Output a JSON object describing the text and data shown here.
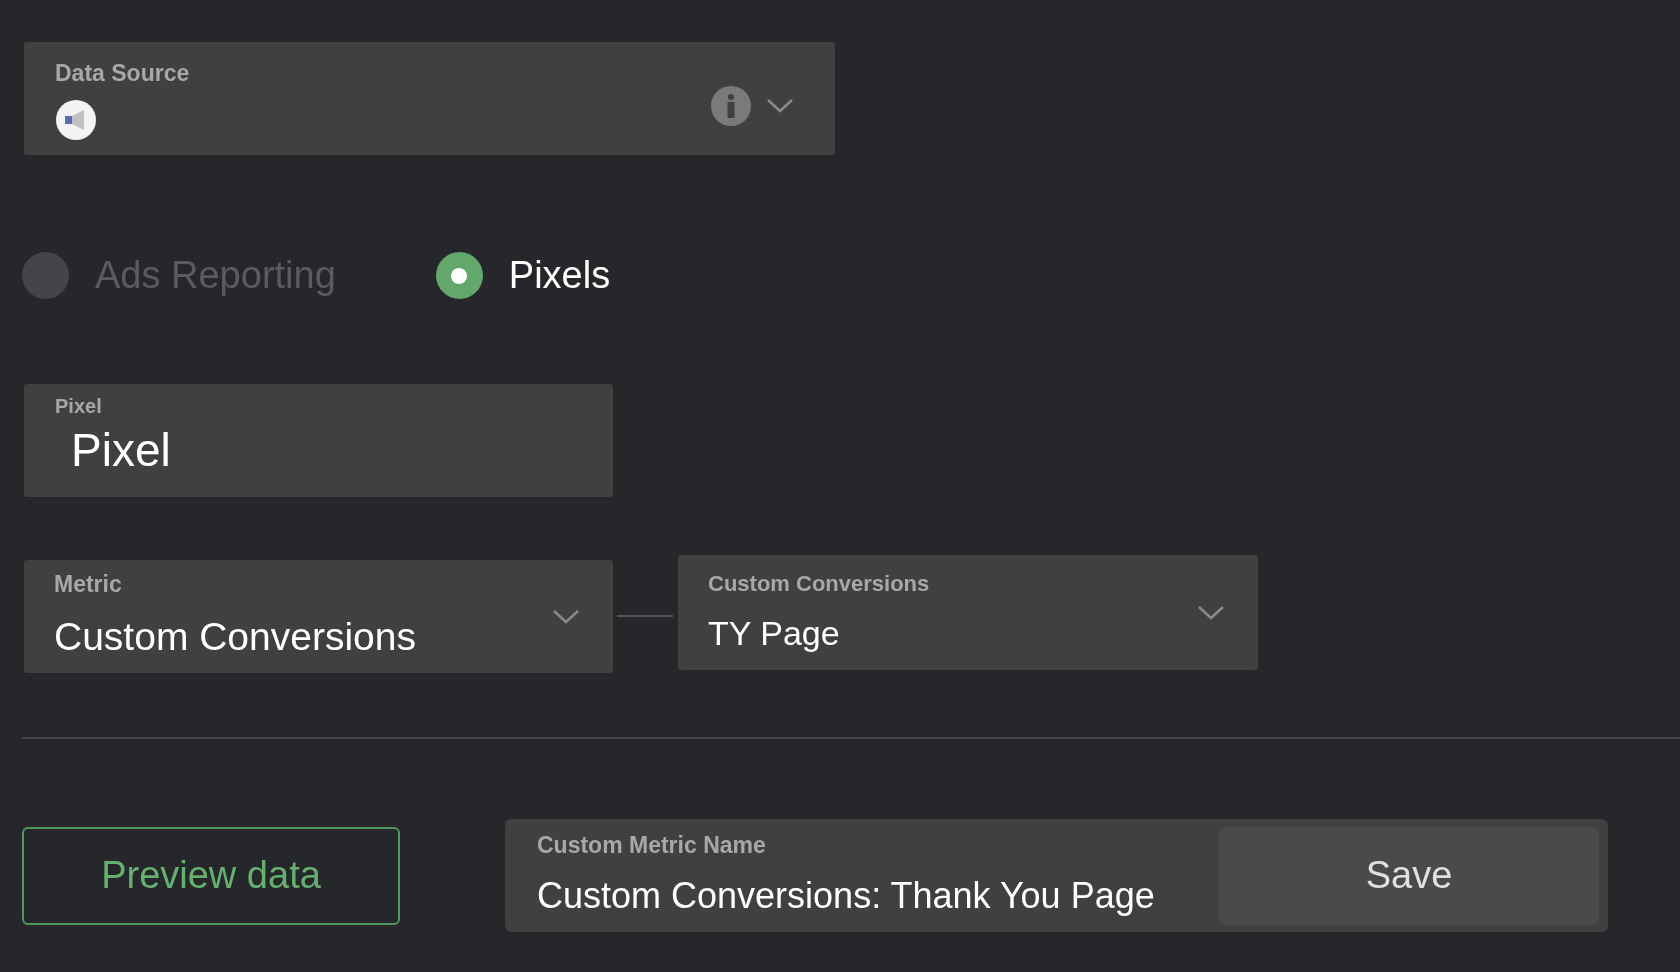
{
  "data_source": {
    "label": "Data Source"
  },
  "source_type": [
    {
      "label": "Ads Reporting",
      "selected": false
    },
    {
      "label": "Pixels",
      "selected": true
    }
  ],
  "pixel": {
    "label": "Pixel",
    "value": "Pixel"
  },
  "metric": {
    "label": "Metric",
    "value": "Custom Conversions"
  },
  "custom_conversions": {
    "label": "Custom Conversions",
    "value": "TY Page"
  },
  "preview_button": "Preview data",
  "custom_metric_name": {
    "label": "Custom Metric Name",
    "value": "Custom Conversions: Thank You Page"
  },
  "save_button": "Save"
}
